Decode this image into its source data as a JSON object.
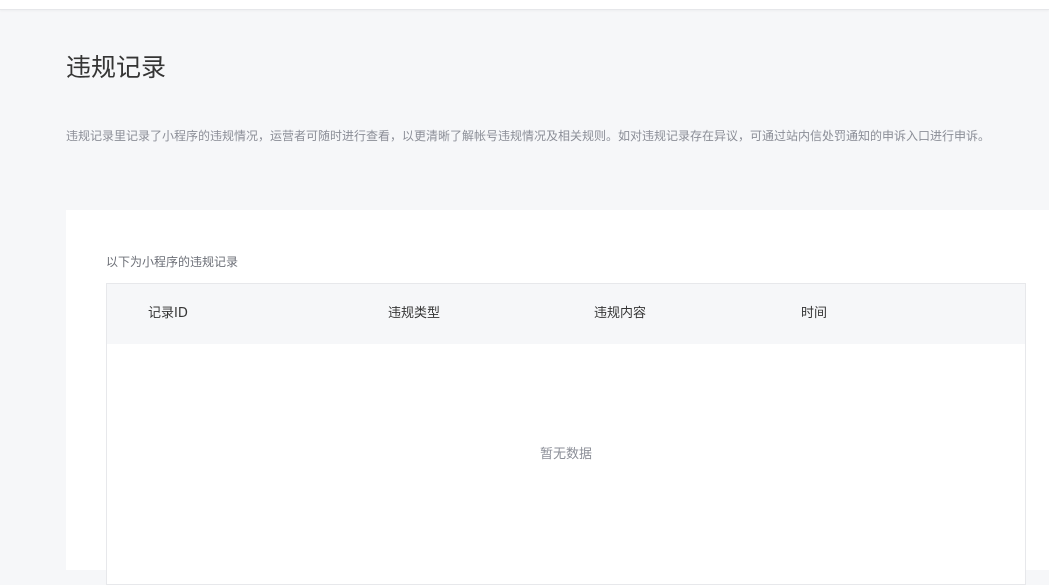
{
  "page": {
    "title": "违规记录",
    "description": "违规记录里记录了小程序的违规情况，运营者可随时进行查看，以更清晰了解帐号违规情况及相关规则。如对违规记录存在异议，可通过站内信处罚通知的申诉入口进行申诉。"
  },
  "records": {
    "label": "以下为小程序的违规记录",
    "columns": [
      "记录ID",
      "违规类型",
      "违规内容",
      "时间"
    ],
    "rows": [],
    "empty_text": "暂无数据"
  }
}
